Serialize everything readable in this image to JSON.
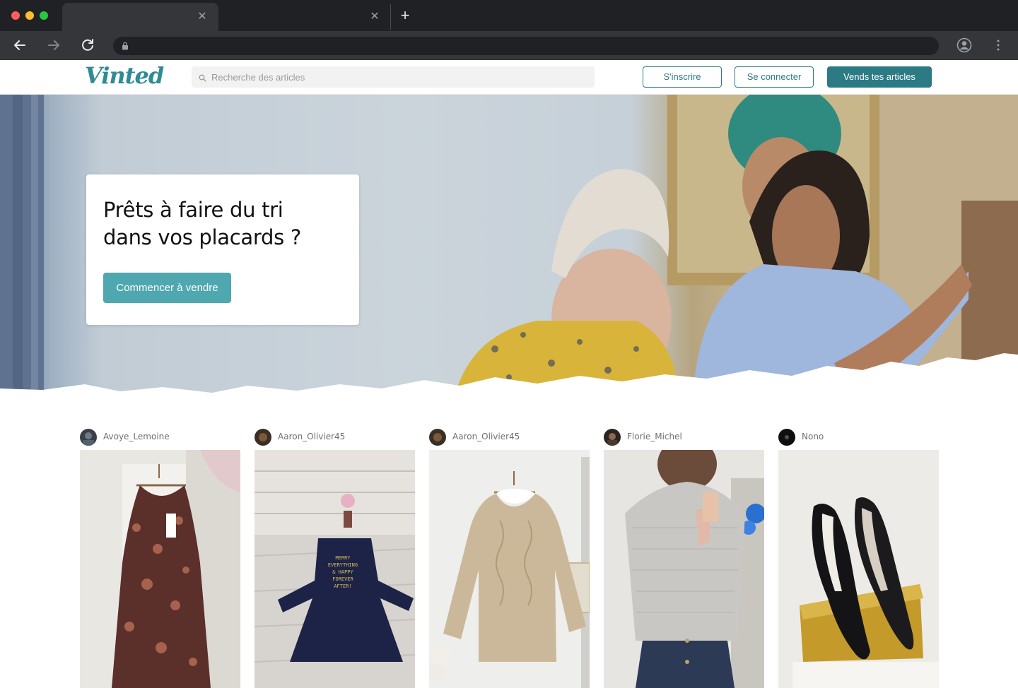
{
  "browser": {
    "tabs": [
      {
        "title": "",
        "active": true
      },
      {
        "title": "",
        "active": false
      }
    ],
    "address": ""
  },
  "header": {
    "logo_text": "Vinted",
    "search_placeholder": "Recherche des articles",
    "signup_label": "S'inscrire",
    "login_label": "Se connecter",
    "sell_label": "Vends tes articles"
  },
  "hero": {
    "title_line1": "Prêts à faire du tri",
    "title_line2": "dans vos placards ?",
    "cta_label": "Commencer à vendre"
  },
  "colors": {
    "brand": "#2b7a84",
    "cta": "#4fa7b0"
  },
  "items": [
    {
      "username": "Avoye_Lemoine",
      "photo": "paisley-dress"
    },
    {
      "username": "Aaron_Olivier45",
      "photo": "navy-christmas-dress"
    },
    {
      "username": "Aaron_Olivier45",
      "photo": "beige-cable-knit-sweater"
    },
    {
      "username": "Florie_Michel",
      "photo": "grey-knit-top-mirror-selfie"
    },
    {
      "username": "Nono",
      "photo": "black-suede-pumps"
    }
  ]
}
